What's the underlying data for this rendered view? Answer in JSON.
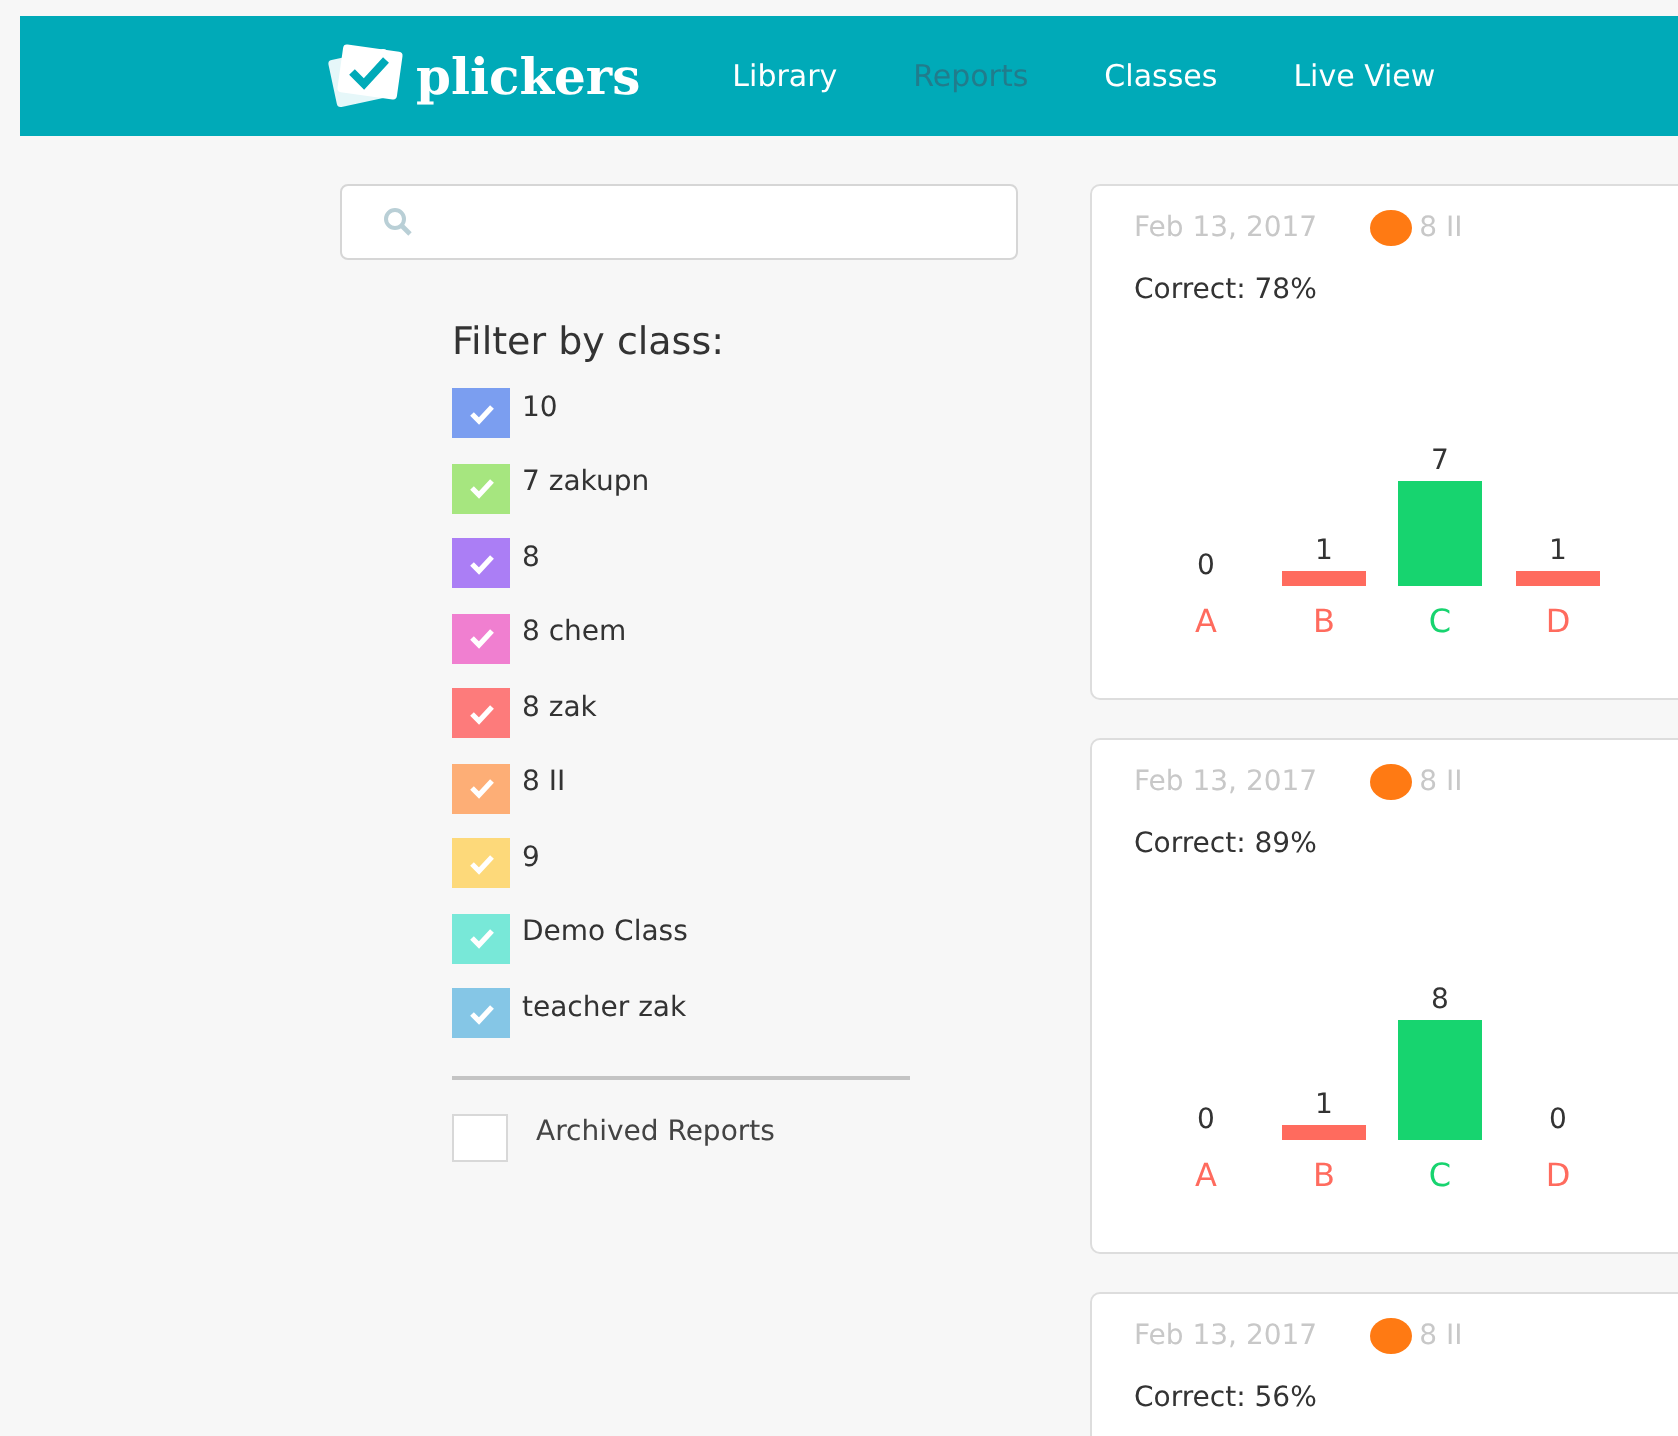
{
  "header": {
    "logo": "plickers",
    "nav": [
      {
        "label": "Library",
        "selected": false
      },
      {
        "label": "Reports",
        "selected": true
      },
      {
        "label": "Classes",
        "selected": false
      },
      {
        "label": "Live View",
        "selected": false
      }
    ]
  },
  "sidebar": {
    "filter_title": "Filter by class:",
    "classes": [
      {
        "label": "10",
        "color": "#7b9ef0",
        "checked": true
      },
      {
        "label": "7 zakupn",
        "color": "#a6e67f",
        "checked": true
      },
      {
        "label": "8",
        "color": "#ab7ef5",
        "checked": true
      },
      {
        "label": "8 chem",
        "color": "#f07fd0",
        "checked": true
      },
      {
        "label": "8 zak",
        "color": "#fd7b7b",
        "checked": true
      },
      {
        "label": "8 II",
        "color": "#fdae76",
        "checked": true
      },
      {
        "label": "9",
        "color": "#fdd97a",
        "checked": true
      },
      {
        "label": "Demo Class",
        "color": "#78e8d8",
        "checked": true
      },
      {
        "label": "teacher zak",
        "color": "#85c6e6",
        "checked": true
      }
    ],
    "archived": {
      "label": "Archived Reports",
      "checked": false
    }
  },
  "reports": [
    {
      "date": "Feb 13, 2017",
      "class": {
        "label": "8 II",
        "color": "#ff7a13"
      },
      "correct": "Correct: 78%",
      "answers": [
        {
          "correct": false
        },
        {
          "correct": false
        },
        {
          "correct": true
        },
        {
          "correct": false
        }
      ],
      "chart_data": {
        "type": "bar",
        "categories": [
          "A",
          "B",
          "C",
          "D"
        ],
        "values": [
          0,
          1,
          7,
          1
        ],
        "data_labels": true
      }
    },
    {
      "date": "Feb 13, 2017",
      "class": {
        "label": "8 II",
        "color": "#ff7a13"
      },
      "correct": "Correct: 89%",
      "answers": [
        {
          "correct": false
        },
        {
          "correct": false
        },
        {
          "correct": true
        },
        {
          "correct": false
        }
      ],
      "chart_data": {
        "type": "bar",
        "categories": [
          "A",
          "B",
          "C",
          "D"
        ],
        "values": [
          0,
          1,
          8,
          0
        ],
        "data_labels": true
      }
    },
    {
      "date": "Feb 13, 2017",
      "class": {
        "label": "8 II",
        "color": "#ff7a13"
      },
      "correct": "Correct: 56%"
    }
  ]
}
